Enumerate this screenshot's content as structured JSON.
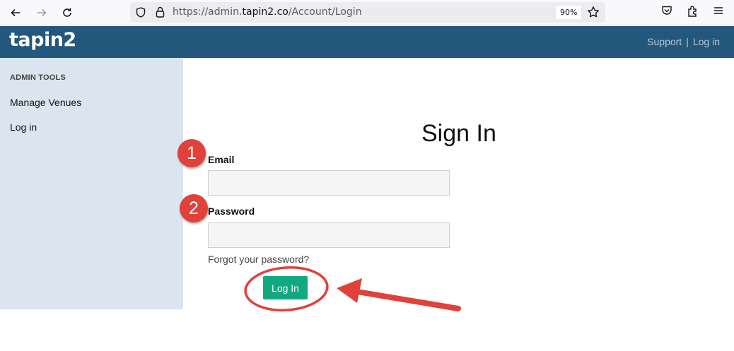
{
  "browser": {
    "url_prefix": "https://admin.",
    "url_host": "tapin2.co",
    "url_path": "/Account/Login",
    "zoom": "90%"
  },
  "header": {
    "logo": "tapin2",
    "support_link": "Support",
    "separator": "|",
    "login_link": "Log in",
    "background": "#23577b"
  },
  "sidebar": {
    "heading": "ADMIN TOOLS",
    "items": [
      {
        "label": "Manage Venues"
      },
      {
        "label": "Log in"
      }
    ],
    "background": "#dae5ef"
  },
  "form": {
    "title": "Sign In",
    "email_label": "Email",
    "email_value": "",
    "password_label": "Password",
    "password_value": "",
    "forgot_link": "Forgot your password?",
    "submit_label": "Log In",
    "submit_color": "#12a981"
  },
  "annotations": {
    "step_1": "1",
    "step_2": "2",
    "color": "#e0413b"
  }
}
